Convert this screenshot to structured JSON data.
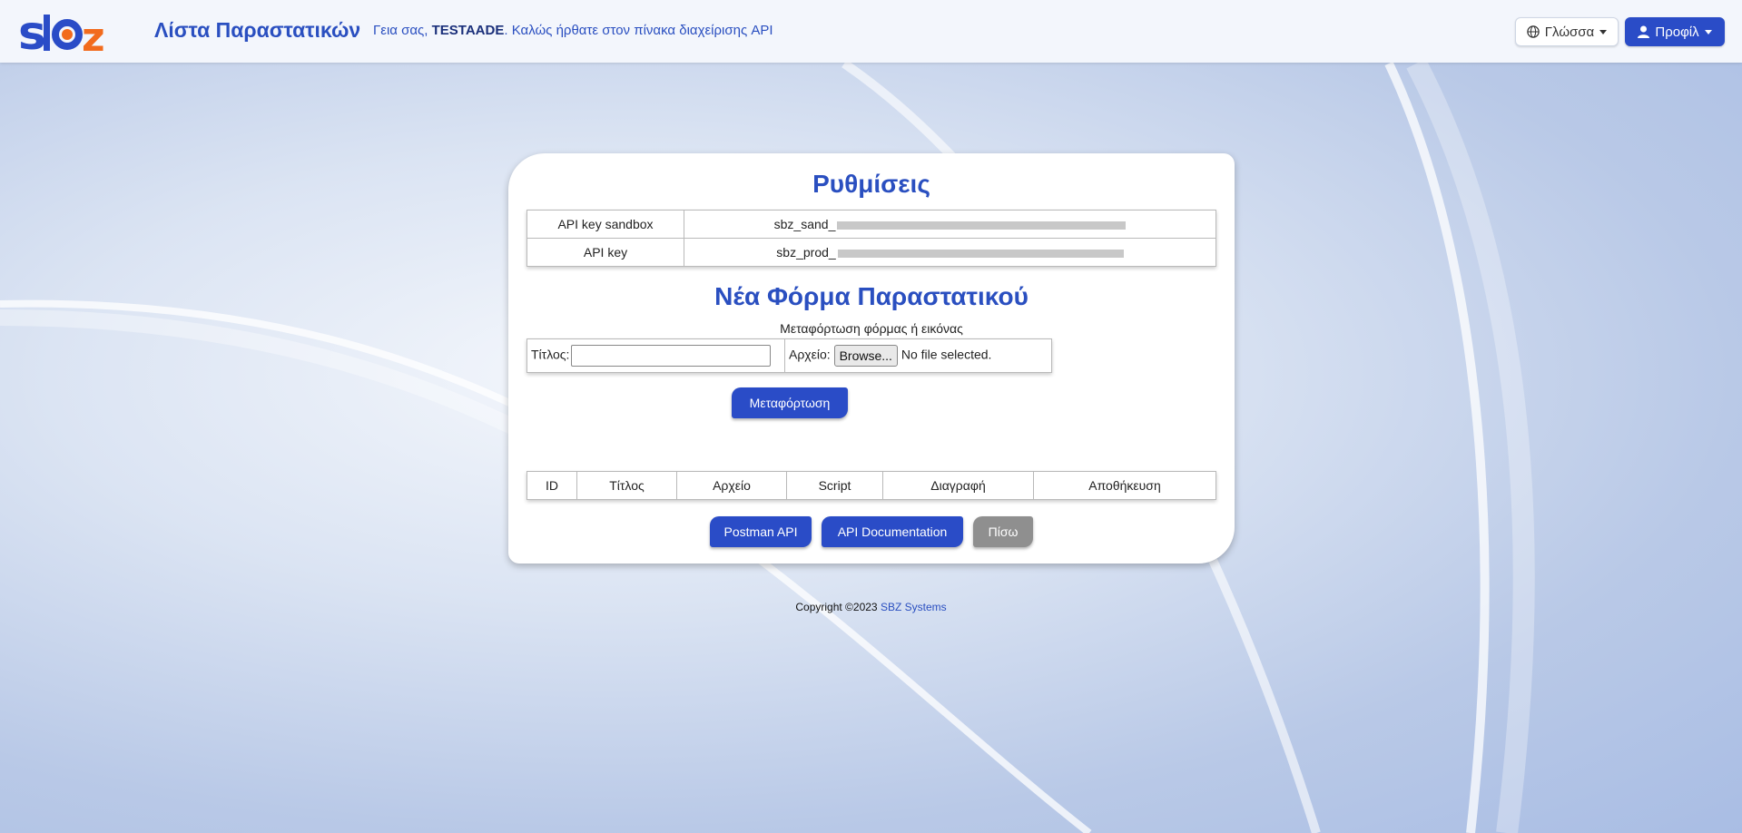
{
  "header": {
    "logo_text": "sbz",
    "title": "Λίστα Παραστατικών",
    "greeting_prefix": "Γεια σας,",
    "username": "TESTAADE",
    "greeting_suffix": ". Καλώς ήρθατε στον πίνακα διαχείρισης API",
    "language_button": "Γλώσσα",
    "profile_button": "Προφίλ",
    "icons": {
      "language": "globe-icon",
      "profile": "user-icon"
    },
    "colors": {
      "brand_blue": "#2a4cc7",
      "logo_orange": "#f26b1d"
    }
  },
  "settings": {
    "heading": "Ρυθμίσεις",
    "rows": [
      {
        "label": "API key sandbox",
        "value_prefix": "sbz_sand_"
      },
      {
        "label": "API key",
        "value_prefix": "sbz_prod_"
      }
    ]
  },
  "new_form": {
    "heading": "Νέα Φόρμα Παραστατικού",
    "caption": "Μεταφόρτωση φόρμας ή εικόνας",
    "title_label": "Τίτλος:",
    "title_value": "",
    "file_label": "Αρχείο:",
    "browse_label": "Browse...",
    "file_status": "No file selected.",
    "upload_button": "Μεταφόρτωση"
  },
  "documents_table": {
    "columns": [
      "ID",
      "Τίτλος",
      "Αρχείο",
      "Script",
      "Διαγραφή",
      "Αποθήκευση"
    ]
  },
  "actions": {
    "postman": "Postman API",
    "documentation": "API Documentation",
    "back": "Πίσω"
  },
  "footer": {
    "copyright": "Copyright ©2023",
    "company": "SBZ Systems"
  }
}
